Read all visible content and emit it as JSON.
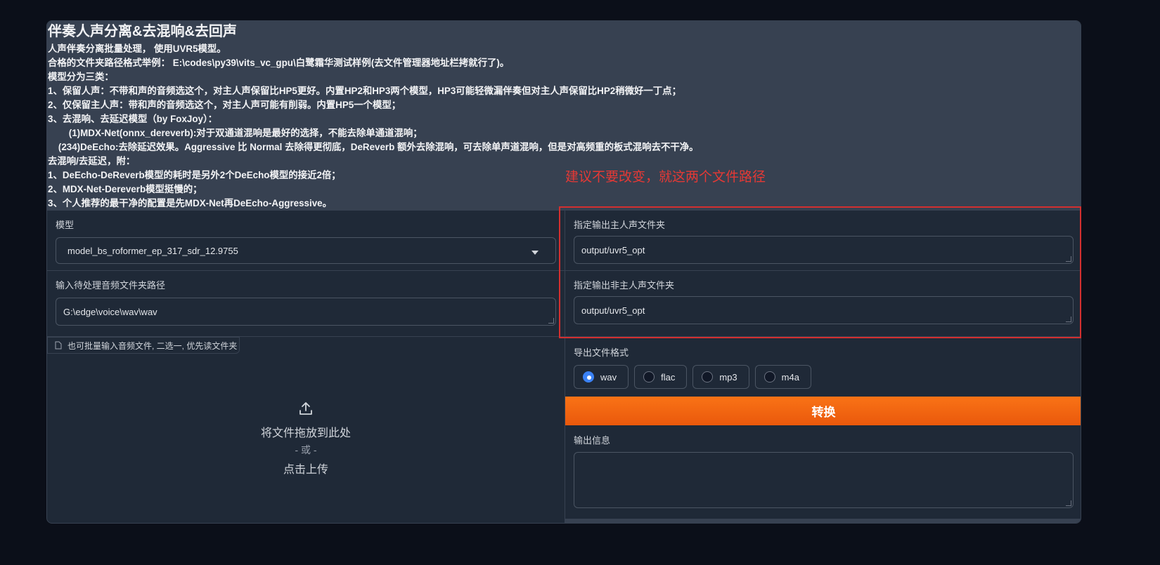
{
  "top_text": "",
  "intro": {
    "title": "伴奏人声分离&去混响&去回声",
    "lines": [
      "人声伴奏分离批量处理， 使用UVR5模型。",
      "合格的文件夹路径格式举例： E:\\codes\\py39\\vits_vc_gpu\\白鹭霜华测试样例(去文件管理器地址栏拷就行了)。",
      "模型分为三类：",
      "1、保留人声：不带和声的音频选这个，对主人声保留比HP5更好。内置HP2和HP3两个模型，HP3可能轻微漏伴奏但对主人声保留比HP2稍微好一丁点；",
      "2、仅保留主人声：带和声的音频选这个，对主人声可能有削弱。内置HP5一个模型；",
      "3、去混响、去延迟模型（by FoxJoy）：",
      "        (1)MDX-Net(onnx_dereverb):对于双通道混响是最好的选择，不能去除单通道混响；",
      "    (234)DeEcho:去除延迟效果。Aggressive 比 Normal 去除得更彻底，DeReverb 额外去除混响，可去除单声道混响，但是对高频重的板式混响去不干净。",
      "去混响/去延迟，附：",
      "1、DeEcho-DeReverb模型的耗时是另外2个DeEcho模型的接近2倍；",
      "2、MDX-Net-Dereverb模型挺慢的；",
      "3、个人推荐的最干净的配置是先MDX-Net再DeEcho-Aggressive。"
    ]
  },
  "annotation": "建议不要改变，就这两个文件路径",
  "model": {
    "label": "模型",
    "value": "model_bs_roformer_ep_317_sdr_12.9755"
  },
  "input_dir": {
    "label": "输入待处理音频文件夹路径",
    "value": "G:\\edge\\voice\\wav\\wav"
  },
  "file_chip": "也可批量输入音频文件, 二选一, 优先读文件夹",
  "upload": {
    "drop": "将文件拖放到此处",
    "or": "- 或 -",
    "click": "点击上传"
  },
  "vocal_out": {
    "label": "指定输出主人声文件夹",
    "value": "output/uvr5_opt"
  },
  "ins_out": {
    "label": "指定输出非主人声文件夹",
    "value": "output/uvr5_opt"
  },
  "format": {
    "label": "导出文件格式",
    "options": [
      "wav",
      "flac",
      "mp3",
      "m4a"
    ],
    "selected": "wav"
  },
  "convert_button": "转换",
  "output_info": {
    "label": "输出信息",
    "value": ""
  },
  "colors": {
    "accent": "#f97316",
    "annotation": "#e53935",
    "radio_selected": "#3b82f6"
  },
  "icons": [
    "chevron-down-icon",
    "file-icon",
    "upload-icon"
  ]
}
